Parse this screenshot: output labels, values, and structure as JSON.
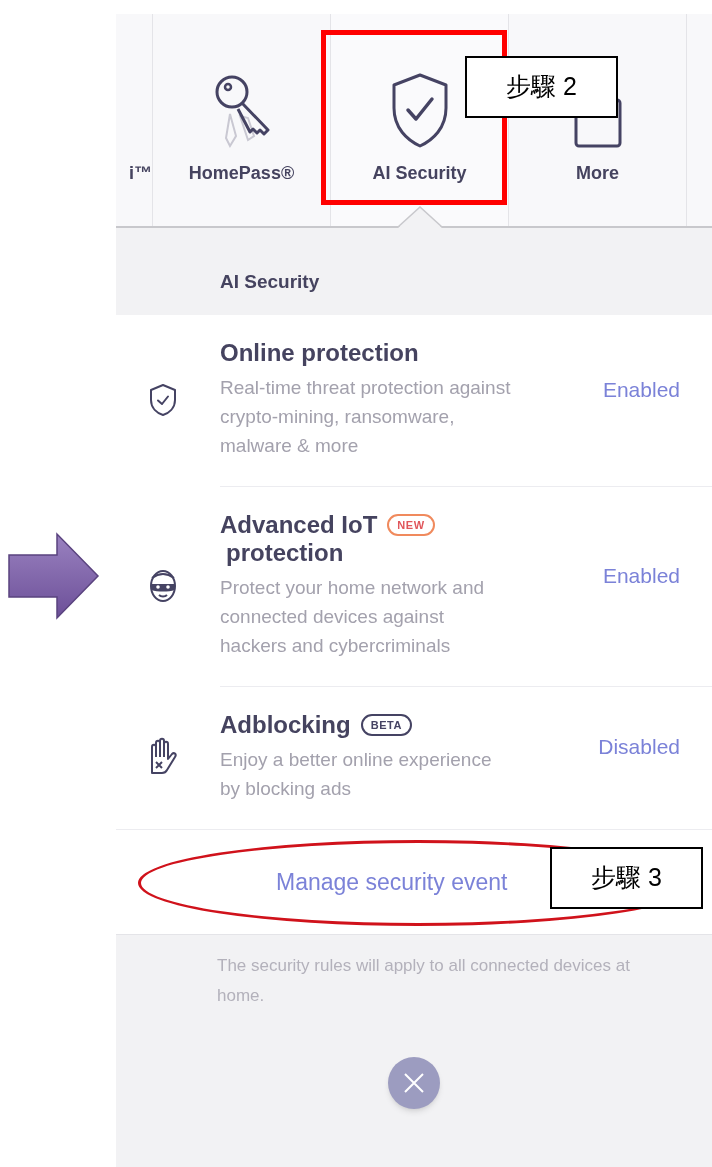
{
  "tabs": [
    {
      "label": "i™",
      "kind": "partial",
      "selected": false
    },
    {
      "label": "HomePass®",
      "kind": "key",
      "selected": false
    },
    {
      "label": "AI Security",
      "kind": "shield",
      "selected": true
    },
    {
      "label": "More",
      "kind": "more",
      "selected": false
    }
  ],
  "section_title": "AI Security",
  "features": [
    {
      "kind": "shield",
      "title": [
        "Online protection"
      ],
      "description": "Real-time threat protection against crypto-mining, ransomware, malware & more",
      "status": "Enabled"
    },
    {
      "kind": "mask",
      "title": [
        "Advanced IoT",
        "protection"
      ],
      "badge": {
        "label": "NEW",
        "kind": "new"
      },
      "description": "Protect your home network and connected devices against hackers and cybercriminals",
      "status": "Enabled"
    },
    {
      "kind": "hand",
      "title": [
        "Adblocking"
      ],
      "badge": {
        "label": "BETA",
        "kind": "beta"
      },
      "description": "Enjoy a better online experience by blocking ads",
      "status": "Disabled"
    }
  ],
  "manage_link": "Manage security event",
  "footer_note": "The security rules will apply to all connected devices at home.",
  "callouts": [
    {
      "label": "步驟 2"
    },
    {
      "label": "步驟 3"
    }
  ]
}
